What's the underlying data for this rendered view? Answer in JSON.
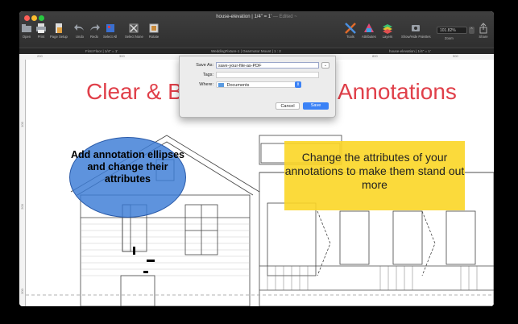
{
  "window": {
    "title": "house-elevation | 1/4\" = 1'",
    "edited": "— Edited ~"
  },
  "toolbar": {
    "left": [
      {
        "label": "Open",
        "icon": "open-icon"
      },
      {
        "label": "Print",
        "icon": "print-icon"
      },
      {
        "label": "Page Setup",
        "icon": "page-setup-icon"
      },
      {
        "label": "Undo",
        "icon": "undo-icon"
      },
      {
        "label": "Redo",
        "icon": "redo-icon"
      },
      {
        "label": "Select All",
        "icon": "select-all-icon"
      },
      {
        "label": "Select None",
        "icon": "select-none-icon"
      },
      {
        "label": "Rotate",
        "icon": "rotate-icon"
      }
    ],
    "right": [
      {
        "label": "Tools",
        "icon": "tools-icon"
      },
      {
        "label": "Attributes",
        "icon": "attributes-icon"
      },
      {
        "label": "Layers",
        "icon": "layers-icon"
      },
      {
        "label": "Show/Hide Palettes",
        "icon": "palettes-icon"
      },
      {
        "label": "Zoom",
        "icon": "zoom-icon"
      },
      {
        "label": "Share",
        "icon": "share-icon"
      }
    ],
    "zoom_value": "101.82%"
  },
  "tabs": {
    "left": "First Floor | 1/4\" = 1'",
    "middle": "WeddingFixture-1 | Gearmotor Mount | 1 : 2",
    "right": "house-elevation | 1/4\" = 1'"
  },
  "rulers": {
    "top": [
      "200",
      "300",
      "800",
      "900"
    ],
    "left": [
      "100",
      "200",
      "300"
    ]
  },
  "canvas": {
    "headline_left": "Clear & B",
    "headline_right": "Annotations",
    "ellipse_text": "Add annotation ellipses and change their attributes",
    "box_text": "Change the attributes of your annotations to make them stand out more"
  },
  "save_dialog": {
    "save_as_label": "Save As:",
    "save_as_value": "save-your-file-as-PDF",
    "tags_label": "Tags:",
    "tags_value": "",
    "where_label": "Where:",
    "where_value": "Documents",
    "cancel_label": "Cancel",
    "save_label": "Save"
  },
  "colors": {
    "accent": "#3b82f6",
    "headline": "#e0404a",
    "highlight": "#fbd626",
    "ellipse": "#3a7bd6"
  }
}
